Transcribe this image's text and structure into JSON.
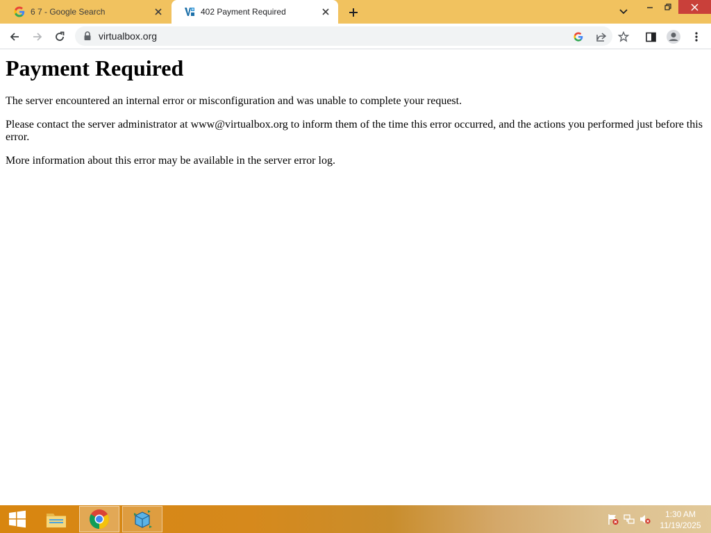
{
  "browser": {
    "tabs": [
      {
        "title": "6 7 - Google Search",
        "favicon": "google-g-icon",
        "active": false
      },
      {
        "title": "402 Payment Required",
        "favicon": "virtualbox-icon",
        "active": true
      }
    ],
    "address": {
      "url": "virtualbox.org"
    },
    "colors": {
      "tabstrip": "#f1c25f",
      "close_button": "#c9403a"
    }
  },
  "page": {
    "heading": "Payment Required",
    "paragraphs": [
      "The server encountered an internal error or misconfiguration and was unable to complete your request.",
      "Please contact the server administrator at www@virtualbox.org to inform them of the time this error occurred, and the actions you performed just before this error.",
      "More information about this error may be available in the server error log."
    ]
  },
  "taskbar": {
    "pinned": [
      "windows-start-icon",
      "file-explorer-icon",
      "chrome-icon",
      "virtualbox-app-icon"
    ],
    "tray": [
      "action-center-flag-icon",
      "network-icon",
      "volume-muted-icon"
    ],
    "clock": {
      "time": "1:30 AM",
      "date": "11/19/2025"
    }
  }
}
